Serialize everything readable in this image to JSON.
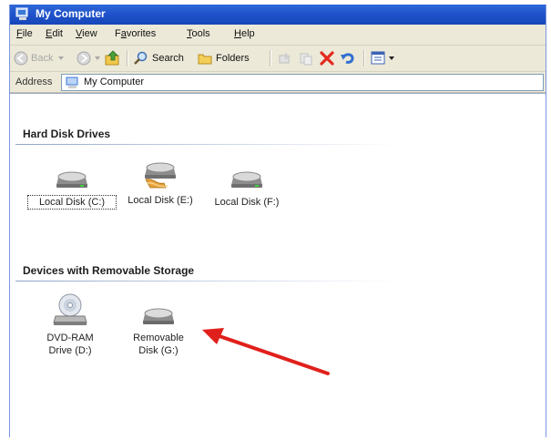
{
  "window": {
    "title": "My Computer"
  },
  "menu": [
    {
      "pre": "",
      "acc": "F",
      "post": "ile"
    },
    {
      "pre": "",
      "acc": "E",
      "post": "dit"
    },
    {
      "pre": "",
      "acc": "V",
      "post": "iew"
    },
    {
      "pre": "F",
      "acc": "a",
      "post": "vorites"
    },
    {
      "pre": "",
      "acc": "T",
      "post": "ools"
    },
    {
      "pre": "",
      "acc": "H",
      "post": "elp"
    }
  ],
  "toolbar": {
    "back_label": "Back",
    "search_label": "Search",
    "folders_label": "Folders"
  },
  "address": {
    "label": "Address",
    "value": "My Computer"
  },
  "groups": {
    "hard_disk": {
      "title": "Hard Disk Drives",
      "drives": [
        "Local Disk (C:)",
        "Local Disk (E:)",
        "Local Disk (F:)"
      ]
    },
    "removable": {
      "title": "Devices with Removable Storage",
      "drives": [
        {
          "line1": "DVD-RAM",
          "line2": "Drive (D:)"
        },
        {
          "line1": "Removable",
          "line2": "Disk (G:)"
        }
      ]
    }
  },
  "colors": {
    "titlebar": "#1d50c9",
    "annotation_arrow": "#e0201c",
    "group_text": "#1e1e1e"
  },
  "icons": [
    "window-icon",
    "back-icon",
    "forward-icon",
    "up-folder-icon",
    "search-icon",
    "folders-icon",
    "move-to-icon",
    "copy-to-icon",
    "delete-icon",
    "undo-icon",
    "views-icon",
    "hard-drive-icon",
    "shared-drive-icon",
    "dvd-drive-icon",
    "removable-drive-icon",
    "red-arrow-icon"
  ]
}
